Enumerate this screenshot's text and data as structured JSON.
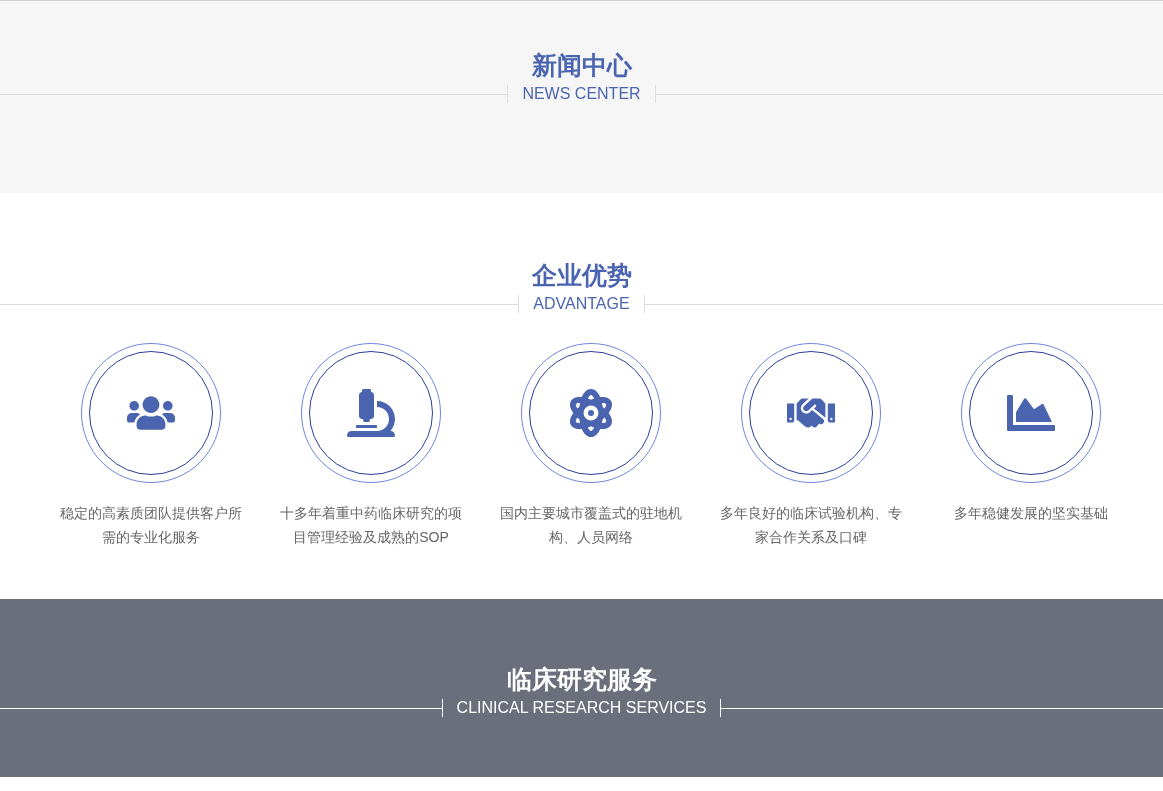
{
  "sections": [
    {
      "kind": "light",
      "title": "新闻中心",
      "subtitle": "NEWS CENTER"
    },
    {
      "kind": "white",
      "title": "企业优势",
      "subtitle": "ADVANTAGE",
      "items": [
        {
          "text": "稳定的高素质团队提供客户所需的专业化服务"
        },
        {
          "text": "十多年着重中药临床研究的项目管理经验及成熟的SOP"
        },
        {
          "text": "国内主要城市覆盖式的驻地机构、人员网络"
        },
        {
          "text": "多年良好的临床试验机构、专家合作关系及口碑"
        },
        {
          "text": "多年稳健发展的坚实基础"
        }
      ]
    },
    {
      "kind": "dark",
      "title": "临床研究服务",
      "subtitle": "CLINICAL RESEARCH SERVICES"
    }
  ]
}
